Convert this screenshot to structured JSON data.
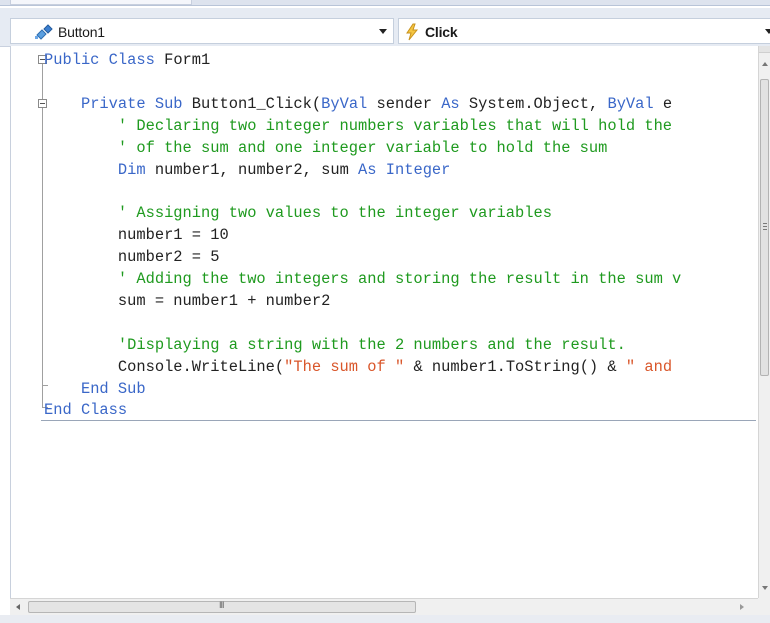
{
  "navigation": {
    "object_dropdown": {
      "icon": "control-object-icon",
      "value": "Button1"
    },
    "event_dropdown": {
      "icon": "lightning-event-icon",
      "value": "Click"
    }
  },
  "code_lines": [
    [
      {
        "t": "kw",
        "v": "Public Class"
      },
      {
        "t": "tx",
        "v": " Form1"
      }
    ],
    [],
    [
      {
        "t": "tx",
        "v": "    "
      },
      {
        "t": "kw",
        "v": "Private Sub"
      },
      {
        "t": "tx",
        "v": " Button1_Click("
      },
      {
        "t": "kw",
        "v": "ByVal"
      },
      {
        "t": "tx",
        "v": " sender "
      },
      {
        "t": "kw",
        "v": "As"
      },
      {
        "t": "tx",
        "v": " System.Object, "
      },
      {
        "t": "kw",
        "v": "ByVal"
      },
      {
        "t": "tx",
        "v": " e"
      }
    ],
    [
      {
        "t": "cm",
        "v": "        ' Declaring two integer numbers variables that will hold the"
      }
    ],
    [
      {
        "t": "cm",
        "v": "        ' of the sum and one integer variable to hold the sum"
      }
    ],
    [
      {
        "t": "tx",
        "v": "        "
      },
      {
        "t": "kw",
        "v": "Dim"
      },
      {
        "t": "tx",
        "v": " number1, number2, sum "
      },
      {
        "t": "kw",
        "v": "As Integer"
      }
    ],
    [],
    [
      {
        "t": "cm",
        "v": "        ' Assigning two values to the integer variables"
      }
    ],
    [
      {
        "t": "tx",
        "v": "        number1 = 10"
      }
    ],
    [
      {
        "t": "tx",
        "v": "        number2 = 5"
      }
    ],
    [
      {
        "t": "cm",
        "v": "        ' Adding the two integers and storing the result in the sum v"
      }
    ],
    [
      {
        "t": "tx",
        "v": "        sum = number1 + number2"
      }
    ],
    [],
    [
      {
        "t": "cm",
        "v": "        'Displaying a string with the 2 numbers and the result."
      }
    ],
    [
      {
        "t": "tx",
        "v": "        Console.WriteLine("
      },
      {
        "t": "st",
        "v": "\"The sum of \""
      },
      {
        "t": "tx",
        "v": " & number1.ToString() & "
      },
      {
        "t": "st",
        "v": "\" and"
      }
    ],
    [
      {
        "t": "tx",
        "v": "    "
      },
      {
        "t": "kw",
        "v": "End Sub"
      }
    ],
    [
      {
        "t": "kw",
        "v": "End Class"
      }
    ]
  ],
  "scrollbars": {
    "horizontal_grip": "III"
  },
  "colors": {
    "keyword": "#3a67c8",
    "comment": "#1f9a1f",
    "string": "#d9562a",
    "text": "#222222"
  }
}
